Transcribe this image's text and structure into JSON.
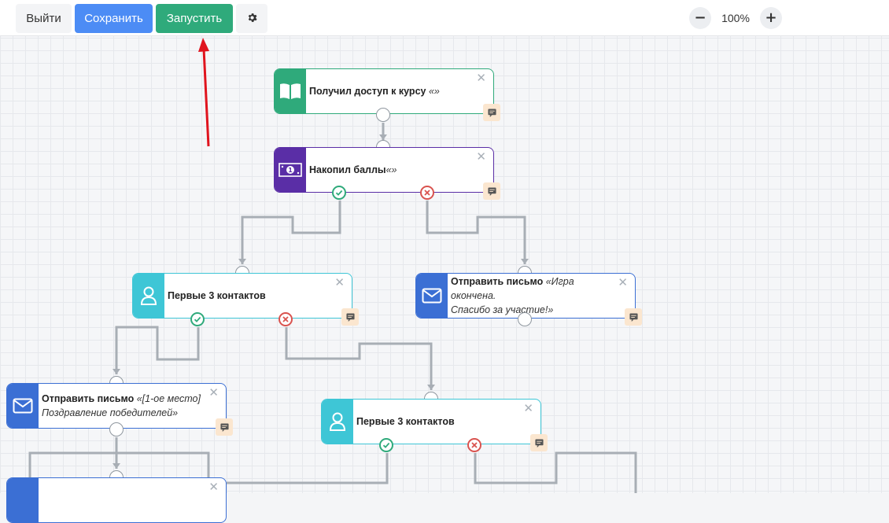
{
  "toolbar": {
    "exit_label": "Выйти",
    "save_label": "Сохранить",
    "run_label": "Запустить",
    "zoom_level": "100%",
    "zoom_out": "−",
    "zoom_in": "+"
  },
  "nodes": {
    "course_access": {
      "title": "Получил доступ к курсу",
      "detail": "«»"
    },
    "points": {
      "title": "Накопил баллы",
      "detail": "«»"
    },
    "first3_a": {
      "title": "Первые 3 контактов"
    },
    "send_game_over": {
      "title": "Отправить письмо",
      "detail_line1": "«Игра окончена.",
      "detail_line2": "Спасибо за участие!»"
    },
    "send_winners": {
      "title": "Отправить письмо",
      "detail_line1": "«[1-ое место]",
      "detail_line2": "Поздравление победителей»"
    },
    "first3_b": {
      "title": "Первые 3 контактов"
    }
  },
  "colors": {
    "save": "#4c8cf5",
    "run": "#2faa7b",
    "course_access": "#2faa7b",
    "points": "#5a2ea6",
    "contacts": "#3ec6d6",
    "email": "#3b6fd4",
    "arrow_annotation": "#e0141e"
  },
  "icons": {
    "settings": "gear-icon",
    "course": "book-icon",
    "points": "money-icon",
    "contacts": "user-icon",
    "email": "envelope-icon",
    "note": "comment-icon",
    "close": "close-icon"
  }
}
